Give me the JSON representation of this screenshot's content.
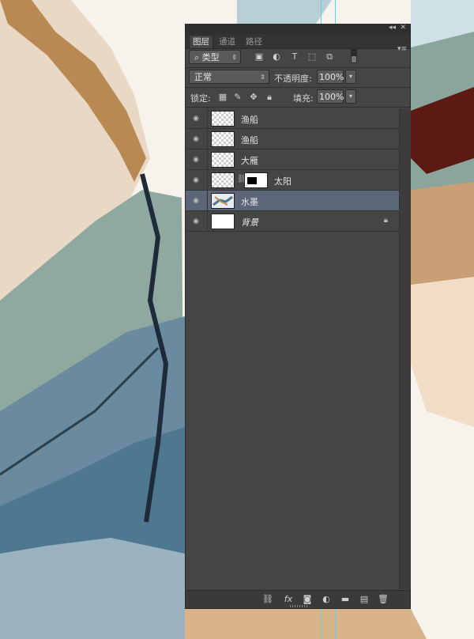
{
  "colors": {
    "panel_bg": "#454545",
    "selected_row": "#5b6679",
    "guide": "#5fd4e8"
  },
  "panel": {
    "tabs": [
      "图层",
      "通道",
      "路径"
    ],
    "active_tab": "图层",
    "filter": {
      "label": "类型",
      "icons": [
        "image-icon",
        "adjustment-icon",
        "type-icon",
        "shape-icon",
        "smart-object-icon",
        "filter-toggle"
      ]
    },
    "blend_mode": "正常",
    "opacity_label": "不透明度:",
    "opacity_value": "100%",
    "lock_label": "锁定:",
    "fill_label": "填充:",
    "fill_value": "100%"
  },
  "layers": [
    {
      "name": "渔船",
      "thumb": "transparent",
      "mask": false,
      "locked": false,
      "selected": false,
      "italic": false
    },
    {
      "name": "渔船",
      "thumb": "transparent",
      "mask": false,
      "locked": false,
      "selected": false,
      "italic": false
    },
    {
      "name": "大雁",
      "thumb": "transparent",
      "mask": false,
      "locked": false,
      "selected": false,
      "italic": false
    },
    {
      "name": "太阳",
      "thumb": "transparent",
      "mask": true,
      "locked": false,
      "selected": false,
      "italic": false
    },
    {
      "name": "水墨",
      "thumb": "ink",
      "mask": false,
      "locked": false,
      "selected": true,
      "italic": false
    },
    {
      "name": "背景",
      "thumb": "white",
      "mask": false,
      "locked": true,
      "selected": false,
      "italic": true
    }
  ]
}
